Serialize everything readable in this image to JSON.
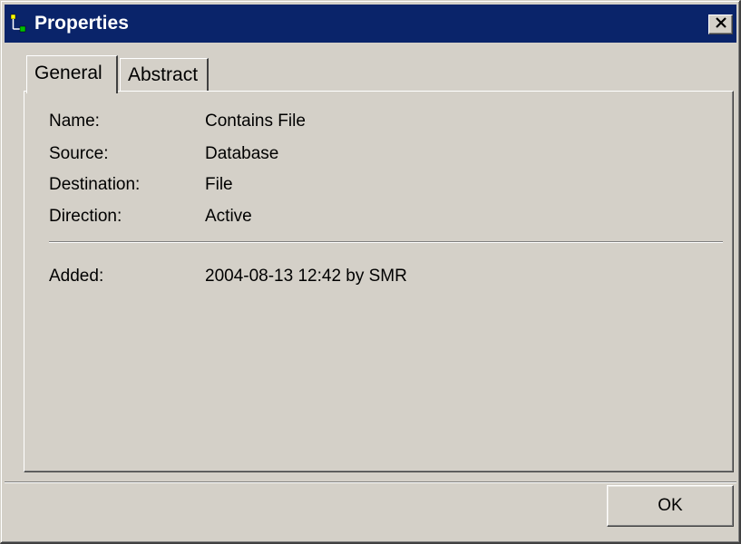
{
  "window": {
    "title": "Properties",
    "icon": "properties-tree-icon",
    "close_icon": "close-icon"
  },
  "tabs": [
    {
      "label": "General",
      "active": true
    },
    {
      "label": "Abstract",
      "active": false
    }
  ],
  "general": {
    "fields": [
      {
        "label": "Name:",
        "value": "Contains File"
      },
      {
        "label": "Source:",
        "value": "Database"
      },
      {
        "label": "Destination:",
        "value": "File"
      },
      {
        "label": "Direction:",
        "value": "Active"
      }
    ],
    "added": {
      "label": "Added:",
      "value": "2004-08-13 12:42 by SMR"
    }
  },
  "buttons": {
    "ok_label": "OK"
  },
  "colors": {
    "titlebar": "#0a246a",
    "face": "#d4d0c8",
    "title_text": "#ffffff"
  }
}
